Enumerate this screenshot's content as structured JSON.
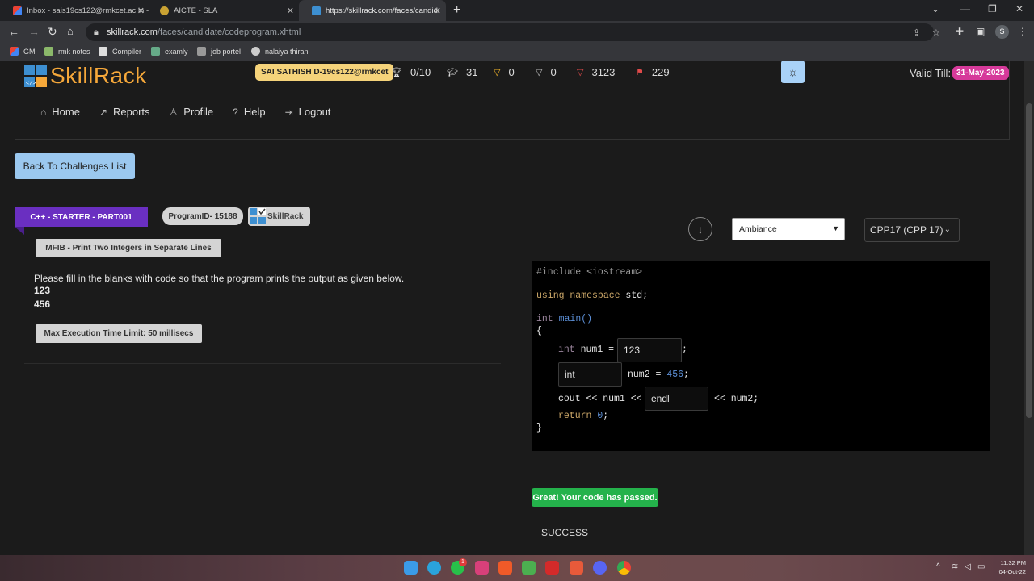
{
  "browser": {
    "tabs": [
      {
        "title": "Inbox - sais19cs122@rmkcet.ac.in -",
        "icon": "gmail-icon",
        "active": false
      },
      {
        "title": "AICTE - SLA",
        "icon": "aicte-icon",
        "active": false
      },
      {
        "title": "https://skillrack.com/faces/candidat",
        "icon": "skillrack-icon",
        "active": true
      }
    ],
    "url_domain": "skillrack.com",
    "url_path": "/faces/candidate/codeprogram.xhtml",
    "profile_initial": "S",
    "bookmarks": [
      "GM",
      "rmk notes",
      "Compiler",
      "examly",
      "job portel",
      "nalaiya thiran"
    ]
  },
  "header": {
    "logo_text": "SkillRack",
    "user": "SAI SATHISH D-19cs122@rmkcet",
    "stats": [
      {
        "icon": "trophy-icon",
        "value": "0/10"
      },
      {
        "icon": "graduation-cap-icon",
        "value": "31"
      },
      {
        "icon": "gold-medal-icon",
        "value": "0"
      },
      {
        "icon": "silver-medal-icon",
        "value": "0"
      },
      {
        "icon": "red-medal-icon",
        "value": "3123"
      },
      {
        "icon": "flag-icon",
        "value": "229"
      }
    ],
    "valid_till_label": "Valid Till:",
    "valid_till_date": "31-May-2023"
  },
  "nav": [
    {
      "label": "Home",
      "icon": "home-icon"
    },
    {
      "label": "Reports",
      "icon": "chart-icon"
    },
    {
      "label": "Profile",
      "icon": "user-icon"
    },
    {
      "label": "Help",
      "icon": "question-icon"
    },
    {
      "label": "Logout",
      "icon": "logout-icon"
    }
  ],
  "back_button": "Back To Challenges List",
  "problem": {
    "track": "C++ - STARTER - PART001",
    "program_id": "ProgramID- 15188",
    "source": "SkillRack",
    "title": "MFIB - Print Two Integers in Separate Lines",
    "description": "Please fill in the blanks with code so that the program prints the output as given below.",
    "output_lines": [
      "123",
      "456"
    ],
    "time_limit": "Max Execution Time Limit: 50 millisecs"
  },
  "editor": {
    "theme": "Ambiance",
    "language": "CPP17 (CPP 17)",
    "code": {
      "include": "#include <iostream>",
      "using_kw": "using namespace",
      "using_rest": " std;",
      "main_type": "int",
      "main_fn": " main()",
      "open_brace": "{",
      "l1_type": "int",
      "l1_var": " num1 =",
      "l1_end": ";",
      "l2_mid": "num2 =",
      "l2_num": "456",
      "l2_end": ";",
      "l3_a": "cout << num1 <<",
      "l3_b": "<< num2;",
      "ret_kw": "return",
      "ret_num": "0",
      "ret_end": ";",
      "close_brace": "}"
    },
    "blanks": [
      "123",
      "int",
      "endl"
    ]
  },
  "result": {
    "message": "Great! Your code has passed.",
    "status": "SUCCESS"
  },
  "taskbar": {
    "time": "11:32 PM",
    "date": "04-Oct-22",
    "whatsapp_badge": "1"
  }
}
